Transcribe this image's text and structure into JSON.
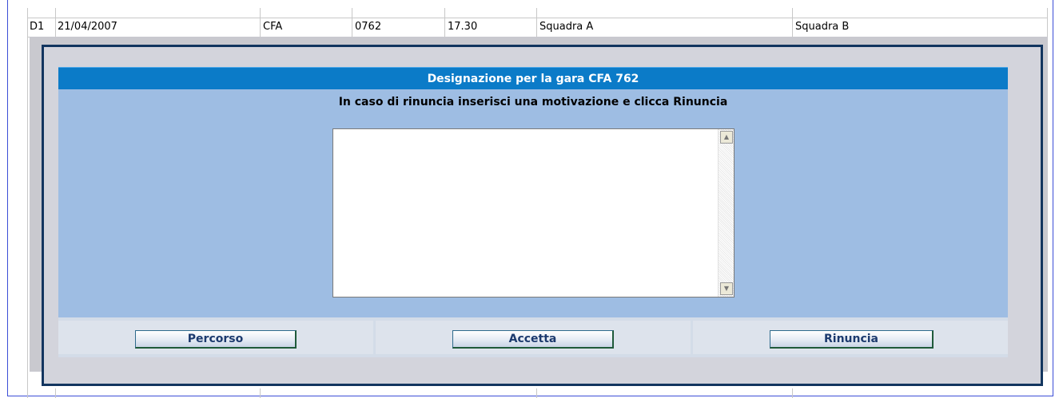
{
  "table_row": {
    "division": "D1",
    "date": "21/04/2007",
    "category": "CFA",
    "match_number": "0762",
    "time": "17.30",
    "home_team": "Squadra A",
    "away_team": "Squadra B"
  },
  "dialog": {
    "title": "Designazione per la gara CFA 762",
    "instruction": "In caso di rinuncia inserisci una motivazione e clicca Rinuncia",
    "motivation_value": "",
    "buttons": {
      "route": "Percorso",
      "accept": "Accetta",
      "decline": "Rinuncia"
    }
  },
  "colors": {
    "title_bar": "#0b7bc8",
    "dialog_body": "#9ebde3",
    "frame_border": "#12355f"
  }
}
